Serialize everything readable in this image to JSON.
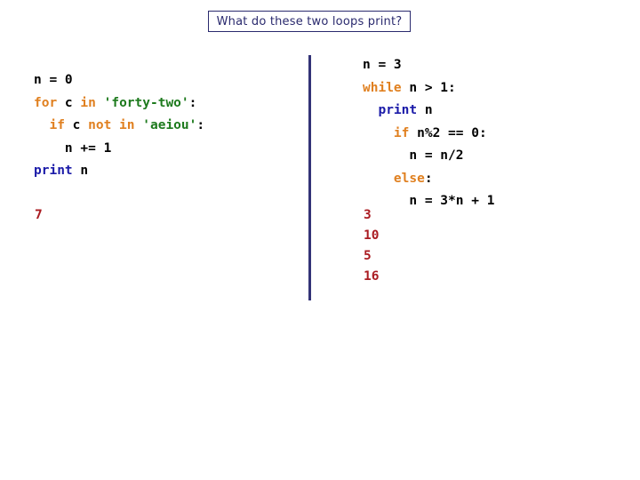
{
  "slide": {
    "title": "What do these two loops print?",
    "background_color": "#ffffff",
    "divider_color": "#333377"
  },
  "colors": {
    "title_text": "#2a2a6e",
    "title_border": "#2a2a6e",
    "keyword": "#e08020",
    "string": "#1d7a1d",
    "builtin": "#1a1aa8",
    "plain": "#000000",
    "output": "#aa1c22"
  },
  "left_panel": {
    "code_text": "n = 0\nfor c in 'forty-two':\n  if c not in 'aeiou':\n    n += 1\nprint n",
    "lines": [
      {
        "indent": "",
        "tokens": [
          {
            "t": "n = 0",
            "c": "pl"
          }
        ]
      },
      {
        "indent": "",
        "tokens": [
          {
            "t": "for",
            "c": "kw"
          },
          {
            "t": " c ",
            "c": "pl"
          },
          {
            "t": "in",
            "c": "kw"
          },
          {
            "t": " ",
            "c": "pl"
          },
          {
            "t": "'forty-two'",
            "c": "str"
          },
          {
            "t": ":",
            "c": "pl"
          }
        ]
      },
      {
        "indent": "  ",
        "tokens": [
          {
            "t": "if",
            "c": "kw"
          },
          {
            "t": " c ",
            "c": "pl"
          },
          {
            "t": "not in",
            "c": "kw"
          },
          {
            "t": " ",
            "c": "pl"
          },
          {
            "t": "'aeiou'",
            "c": "str"
          },
          {
            "t": ":",
            "c": "pl"
          }
        ]
      },
      {
        "indent": "    ",
        "tokens": [
          {
            "t": "n += 1",
            "c": "pl"
          }
        ]
      },
      {
        "indent": "",
        "tokens": [
          {
            "t": "print",
            "c": "bi"
          },
          {
            "t": " n",
            "c": "pl"
          }
        ]
      }
    ],
    "output_lines": [
      "7"
    ],
    "output_text": "7"
  },
  "right_panel": {
    "code_text": "n = 3\nwhile n > 1:\n  print n\n    if n%2 == 0:\n      n = n/2\n    else:\n      n = 3*n + 1",
    "lines": [
      {
        "indent": "",
        "tokens": [
          {
            "t": "n = 3",
            "c": "pl"
          }
        ]
      },
      {
        "indent": "",
        "tokens": [
          {
            "t": "while",
            "c": "kw"
          },
          {
            "t": " n > 1:",
            "c": "pl"
          }
        ]
      },
      {
        "indent": "  ",
        "tokens": [
          {
            "t": "print",
            "c": "bi"
          },
          {
            "t": " n",
            "c": "pl"
          }
        ]
      },
      {
        "indent": "    ",
        "tokens": [
          {
            "t": "if",
            "c": "kw"
          },
          {
            "t": " n%2 == 0:",
            "c": "pl"
          }
        ]
      },
      {
        "indent": "      ",
        "tokens": [
          {
            "t": "n = n/2",
            "c": "pl"
          }
        ]
      },
      {
        "indent": "    ",
        "tokens": [
          {
            "t": "else",
            "c": "kw"
          },
          {
            "t": ":",
            "c": "pl"
          }
        ]
      },
      {
        "indent": "      ",
        "tokens": [
          {
            "t": "n = 3*n + 1",
            "c": "pl"
          }
        ]
      }
    ],
    "output_lines": [
      "3",
      "10",
      "5",
      "16"
    ],
    "output_text": "3\n10\n5\n16"
  }
}
